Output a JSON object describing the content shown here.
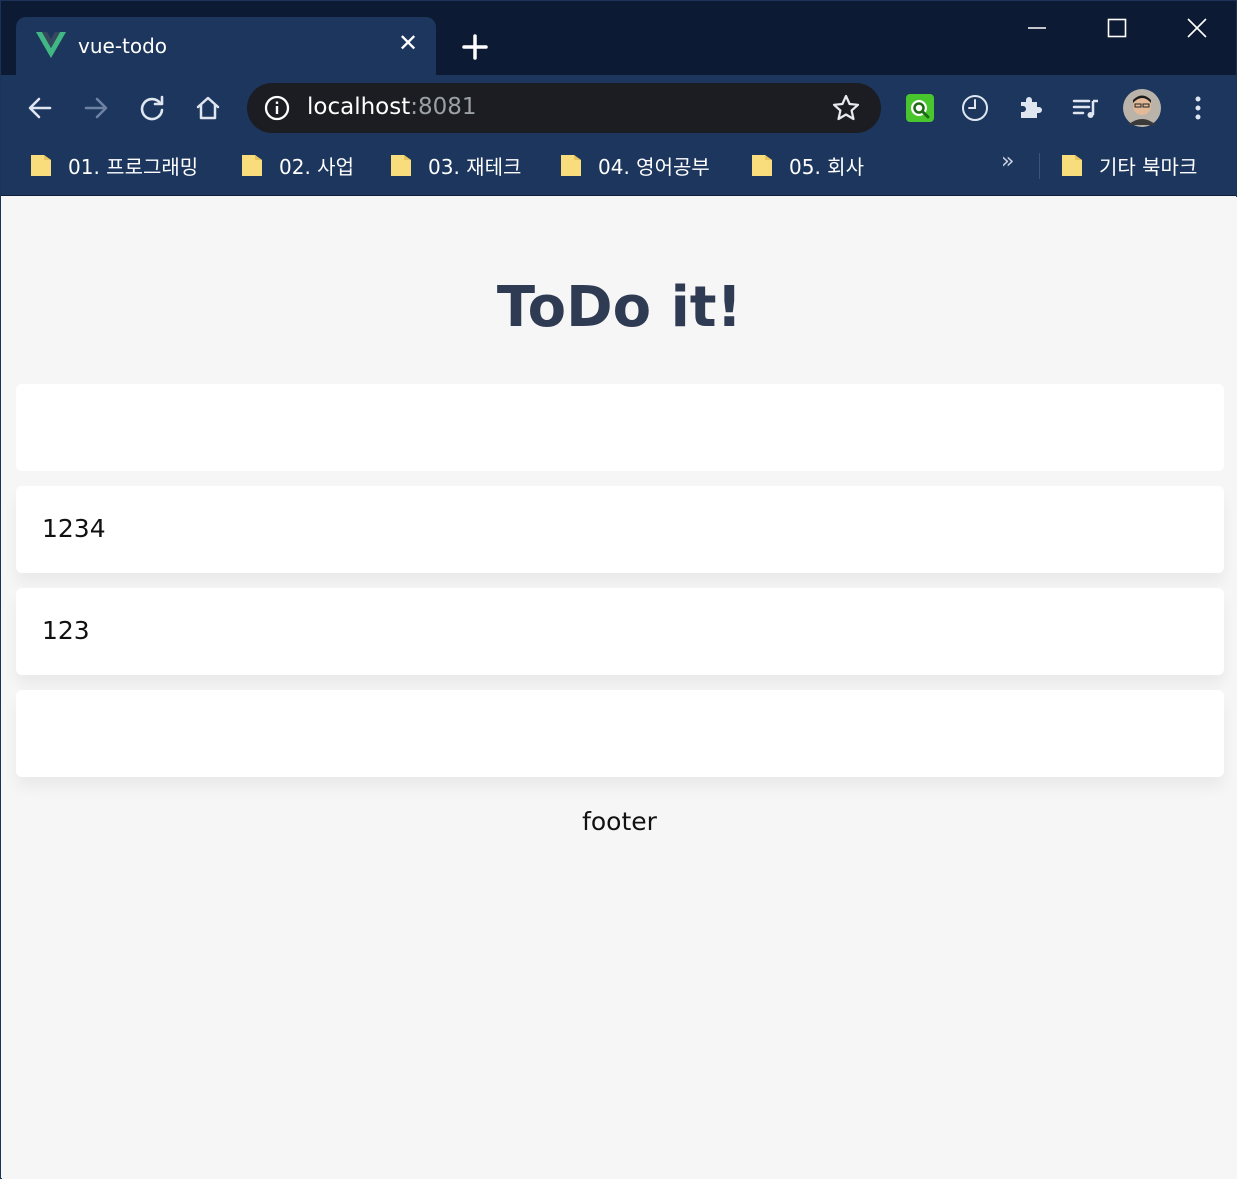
{
  "browser": {
    "tab_title": "vue-todo",
    "tab_close": "✕",
    "url_host": "localhost",
    "url_port": ":8081",
    "accent_color": "#1c365d"
  },
  "bookmarks": {
    "items": [
      {
        "label": "01. 프로그래밍"
      },
      {
        "label": "02. 사업"
      },
      {
        "label": "03. 재테크"
      },
      {
        "label": "04. 영어공부"
      },
      {
        "label": "05. 회사"
      }
    ],
    "more": "»",
    "other": "기타 북마크"
  },
  "app": {
    "title": "ToDo it!",
    "input_value": "",
    "todos": [
      {
        "text": "1234"
      },
      {
        "text": "123"
      },
      {
        "text": ""
      }
    ],
    "footer": "footer"
  }
}
